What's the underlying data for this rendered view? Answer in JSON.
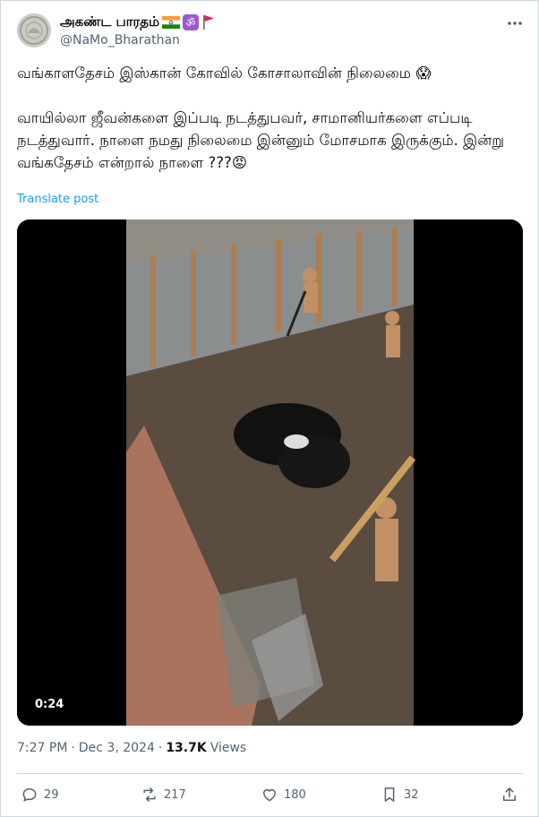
{
  "author": {
    "display_name": "அகண்ட பாரதம்",
    "handle": "@NaMo_Bharathan",
    "badges": [
      "india-flag-icon",
      "om-icon",
      "red-flag-icon"
    ]
  },
  "tweet": {
    "line1": "வங்காளதேசம் இஸ்கான் கோவில் கோசாலாவின் நிலைமை",
    "line1_emoji": "😱",
    "paragraph2": "வாயில்லா ஜீவன்களை இப்படி நடத்துபவர், சாமானியர்களை எப்படி நடத்துவார். நாளை நமது நிலைமை இன்னும் மோசமாக இருக்கும். இன்று வங்கதேசம் என்றால் நாளை ???",
    "paragraph2_emoji": "😡",
    "translate_label": "Translate post"
  },
  "media": {
    "duration": "0:24"
  },
  "meta": {
    "time": "7:27 PM",
    "separator": "·",
    "date": "Dec 3, 2024",
    "views_count": "13.7K",
    "views_label": "Views"
  },
  "actions": {
    "replies": "29",
    "reposts": "217",
    "likes": "180",
    "bookmarks": "32"
  },
  "colors": {
    "text": "#0f1419",
    "secondary": "#536471",
    "link": "#1d9bf0",
    "border": "#cfd9de"
  }
}
